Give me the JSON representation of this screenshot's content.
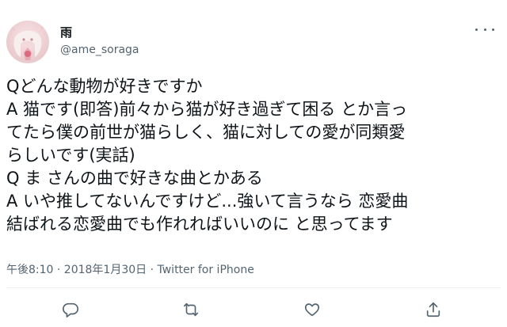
{
  "tweet": {
    "display_name": "雨",
    "handle": "@ame_soraga",
    "avatar_icon": "profile-avatar-illustration",
    "more_icon": "more-dots-icon",
    "lines": [
      "Qどんな動物が好きですか",
      "A 猫です(即答)前々から猫が好き過ぎて困る とか言っ",
      "てたら僕の前世が猫らしく、猫に対しての愛が同類愛",
      "らしいです(実話)",
      "Q ま さんの曲で好きな曲とかある",
      "A いや推してないんですけど...強いて言うなら 恋愛曲",
      "結ばれる恋愛曲でも作れればいいのに と思ってます"
    ],
    "meta": "午後8:10 · 2018年1月30日 · Twitter for iPhone"
  },
  "actions": {
    "reply_icon": "reply-icon",
    "retweet_icon": "retweet-icon",
    "like_icon": "like-icon",
    "share_icon": "share-icon"
  },
  "colors": {
    "text": "#0f1419",
    "secondary": "#536471",
    "divider": "#eff3f4"
  }
}
